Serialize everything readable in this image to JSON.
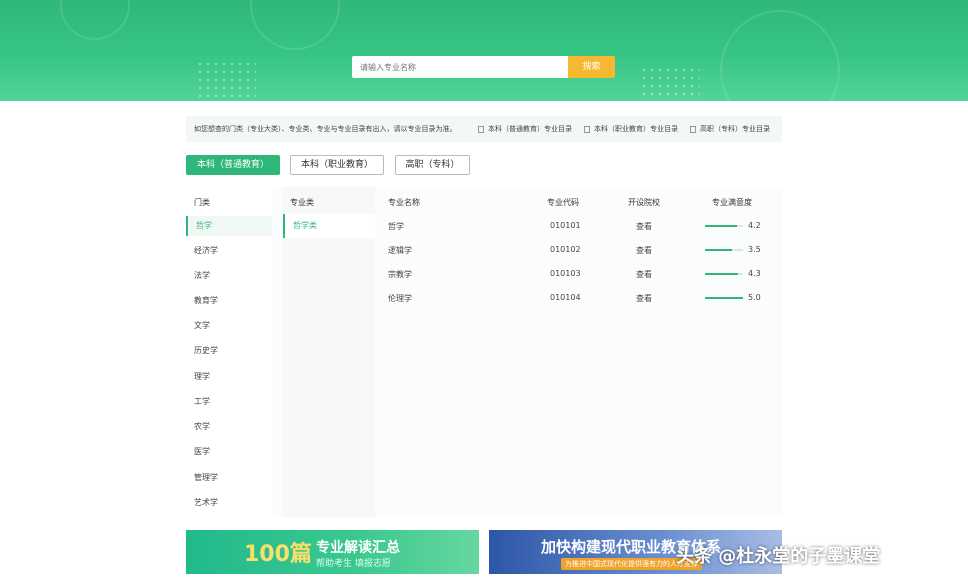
{
  "hero": {
    "title": "",
    "search_placeholder": "请输入专业名称",
    "search_button": "搜索"
  },
  "info": {
    "text": "如您想查的门类（专业大类）、专业类、专业与专业目录有出入，请以专业目录为准。",
    "links": [
      "本科（普通教育）专业目录",
      "本科（职业教育）专业目录",
      "高职（专科）专业目录"
    ]
  },
  "tabs": [
    "本科（普通教育）",
    "本科（职业教育）",
    "高职（专科）"
  ],
  "table": {
    "headers": {
      "category": "门类",
      "subcategory": "专业类",
      "name": "专业名称",
      "code": "专业代码",
      "schools": "开设院校",
      "satisfaction": "专业满意度"
    },
    "categories": [
      "哲学",
      "经济学",
      "法学",
      "教育学",
      "文学",
      "历史学",
      "理学",
      "工学",
      "农学",
      "医学",
      "管理学",
      "艺术学"
    ],
    "subcategories": [
      "哲学类"
    ],
    "rows": [
      {
        "name": "哲学",
        "code": "010101",
        "schools": "查看",
        "score": "4.2",
        "level": 0.84
      },
      {
        "name": "逻辑学",
        "code": "010102",
        "schools": "查看",
        "score": "3.5",
        "level": 0.7
      },
      {
        "name": "宗教学",
        "code": "010103",
        "schools": "查看",
        "score": "4.3",
        "level": 0.86
      },
      {
        "name": "伦理学",
        "code": "010104",
        "schools": "查看",
        "score": "5.0",
        "level": 1.0
      }
    ]
  },
  "banners": {
    "left": {
      "number": "100篇",
      "title": "专业解读汇总",
      "subtitle": "帮助考生 填报志愿"
    },
    "right": {
      "title": "加快构建现代职业教育体系",
      "subtitle": "为推进中国式现代化提供强有力的人才支撑"
    }
  },
  "watermark": "头条 @杜永堂的子墨课堂",
  "colors": {
    "accent": "#2fb77a",
    "button": "#f7b831"
  }
}
